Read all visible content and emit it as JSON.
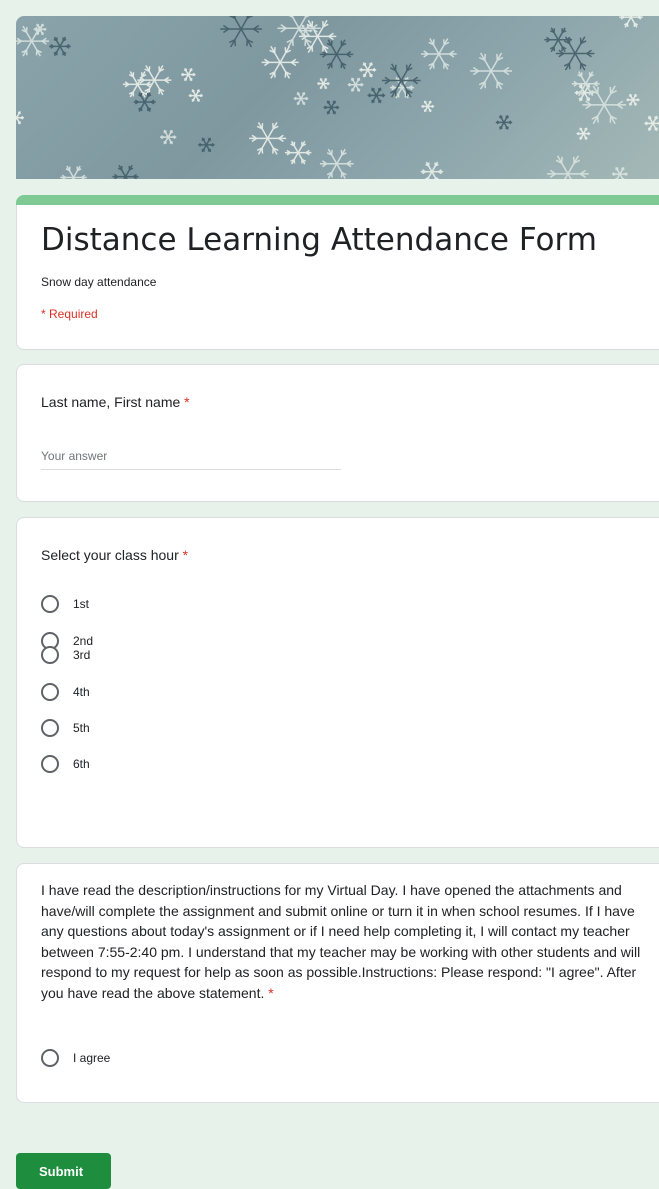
{
  "form": {
    "title": "Distance Learning Attendance Form",
    "description": "Snow day attendance",
    "required_note": "* Required",
    "accent_color": "#7fc994"
  },
  "questions": [
    {
      "title": "Last name, First name",
      "required": "*",
      "placeholder": "Your answer"
    },
    {
      "title": "Select your class hour",
      "required": "*",
      "options": [
        "1st",
        "2nd",
        "3rd",
        "4th",
        "5th",
        "6th"
      ]
    },
    {
      "title": "I have read the description/instructions for my Virtual Day. I have opened the attachments and have/will complete the assignment and submit online or turn it in when school resumes. If I have any questions about today's assignment or if I need help completing it, I will contact my teacher between 7:55-2:40 pm. I understand that my teacher may be working with other students and will respond to my request for help as soon as possible.Instructions: Please respond: \"I agree\". After you have read the above statement.",
      "required": "*",
      "options": [
        "I agree"
      ]
    }
  ],
  "actions": {
    "submit_label": "Submit",
    "submit_color": "#1e8e3e"
  }
}
